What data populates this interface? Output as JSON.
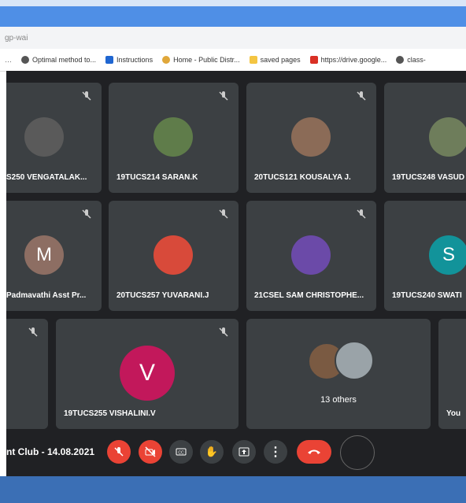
{
  "browser": {
    "url_fragment": "gp-wai",
    "bookmarks": [
      {
        "icon": "globe-icon",
        "label": "Optimal method to..."
      },
      {
        "icon": "instructions-icon",
        "label": "Instructions"
      },
      {
        "icon": "home-icon",
        "label": "Home - Public Distr..."
      },
      {
        "icon": "folder-icon",
        "label": "saved pages"
      },
      {
        "icon": "gmail-icon",
        "label": "https://drive.google..."
      },
      {
        "icon": "globe-icon",
        "label": "class-"
      }
    ]
  },
  "tiles": [
    {
      "name": "S250 VENGATALAK...",
      "avatar": "photo",
      "color": "#5a5a5a"
    },
    {
      "name": "19TUCS214 SARAN.K",
      "avatar": "photo",
      "color": "#5f7c4a"
    },
    {
      "name": "20TUCS121 KOUSALYA J.",
      "avatar": "photo",
      "color": "#8b6b57"
    },
    {
      "name": "19TUCS248 VASUD",
      "avatar": "photo",
      "color": "#6e7d5b"
    },
    {
      "name": "Padmavathi Asst Pr...",
      "avatar": "M",
      "color": "#8d6e63"
    },
    {
      "name": "20TUCS257 YUVARANI.J",
      "avatar": "photo",
      "color": "#d84a3a"
    },
    {
      "name": "21CSEL SAM CHRISTOPHE...",
      "avatar": "photo",
      "color": "#6b4aa8"
    },
    {
      "name": "19TUCS240 SWATI",
      "avatar": "S",
      "color": "#12939a"
    },
    {
      "name": "",
      "avatar": "none",
      "color": "#3c4043"
    },
    {
      "name": "19TUCS255 VISHALINI.V",
      "avatar": "V",
      "color": "#c2185b"
    },
    {
      "name": "13 others",
      "avatar": "group",
      "color": "#3c4043"
    },
    {
      "name": "You",
      "avatar": "none",
      "color": "#3c4043"
    }
  ],
  "controls": {
    "meeting_title": "nt Club - 14.08.2021",
    "buttons": [
      "mic-off-icon",
      "camera-off-icon",
      "captions-icon",
      "raise-hand-icon",
      "present-icon",
      "more-icon",
      "end-call-icon"
    ]
  },
  "colors": {
    "meet_bg": "#202124",
    "tile_bg": "#3c4043",
    "red": "#ea4335"
  }
}
